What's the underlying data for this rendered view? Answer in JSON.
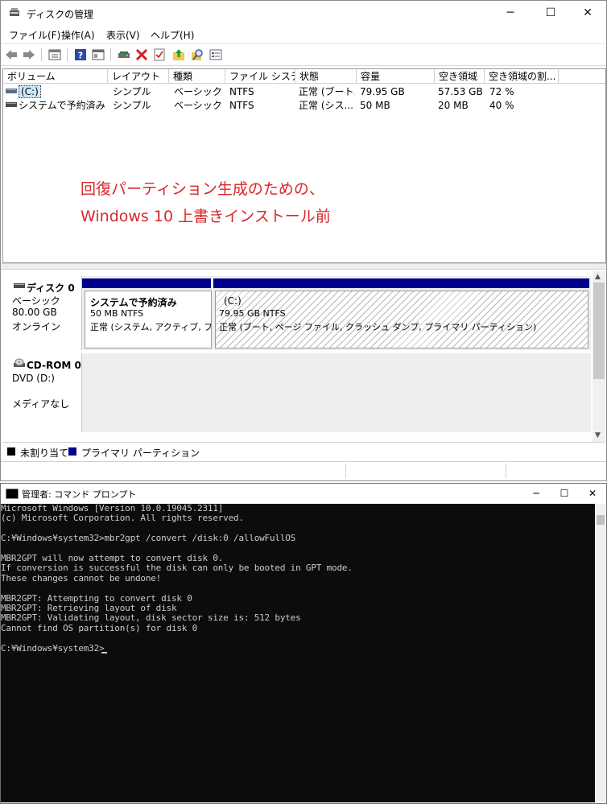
{
  "disk_management": {
    "title": "ディスクの管理",
    "caption": {
      "minimize": "─",
      "maximize": "☐",
      "close": "✕"
    },
    "menu": [
      "ファイル(F)",
      "操作(A)",
      "表示(V)",
      "ヘルプ(H)"
    ],
    "columns": [
      "ボリューム",
      "レイアウト",
      "種類",
      "ファイル システム",
      "状態",
      "容量",
      "空き領域",
      "空き領域の割..."
    ],
    "rows": [
      {
        "volume": "(C:)",
        "layout": "シンプル",
        "type": "ベーシック",
        "fs": "NTFS",
        "status": "正常 (ブート...",
        "capacity": "79.95 GB",
        "free": "57.53 GB",
        "pct": "72 %"
      },
      {
        "volume": "システムで予約済み",
        "layout": "シンプル",
        "type": "ベーシック",
        "fs": "NTFS",
        "status": "正常 (シス...",
        "capacity": "50 MB",
        "free": "20 MB",
        "pct": "40 %"
      }
    ],
    "overlay": {
      "line1": "回復パーティション生成のための、",
      "line2": "Windows 10 上書きインストール前"
    },
    "disk0": {
      "name": "ディスク 0",
      "kind": "ベーシック",
      "size": "80.00 GB",
      "state": "オンライン",
      "partitions": [
        {
          "name": "システムで予約済み",
          "size": "50 MB NTFS",
          "status": "正常 (システム, アクティブ, プライ"
        },
        {
          "name": "(C:)",
          "size": "79.95 GB NTFS",
          "status": "正常 (ブート, ページ ファイル, クラッシュ ダンプ, プライマリ パーティション)"
        }
      ]
    },
    "cdrom": {
      "name": "CD-ROM 0",
      "drive": "DVD (D:)",
      "media": "メディアなし"
    },
    "legend": [
      {
        "label": "未割り当て",
        "color": "#000000"
      },
      {
        "label": "プライマリ パーティション",
        "color": "#00008b"
      }
    ],
    "colors": {
      "primary_partition": "#00008b",
      "overlay_text": "#d9262a",
      "selection": "#cce8ff"
    }
  },
  "command_prompt": {
    "title": "管理者: コマンド プロンプト",
    "caption": {
      "minimize": "─",
      "maximize": "☐",
      "close": "✕"
    },
    "lines": [
      "Microsoft Windows [Version 10.0.19045.2311]",
      "(c) Microsoft Corporation. All rights reserved.",
      "",
      "C:¥Windows¥system32>mbr2gpt /convert /disk:0 /allowFullOS",
      "",
      "MBR2GPT will now attempt to convert disk 0.",
      "If conversion is successful the disk can only be booted in GPT mode.",
      "These changes cannot be undone!",
      "",
      "MBR2GPT: Attempting to convert disk 0",
      "MBR2GPT: Retrieving layout of disk",
      "MBR2GPT: Validating layout, disk sector size is: 512 bytes",
      "Cannot find OS partition(s) for disk 0",
      "",
      "C:¥Windows¥system32>"
    ]
  }
}
